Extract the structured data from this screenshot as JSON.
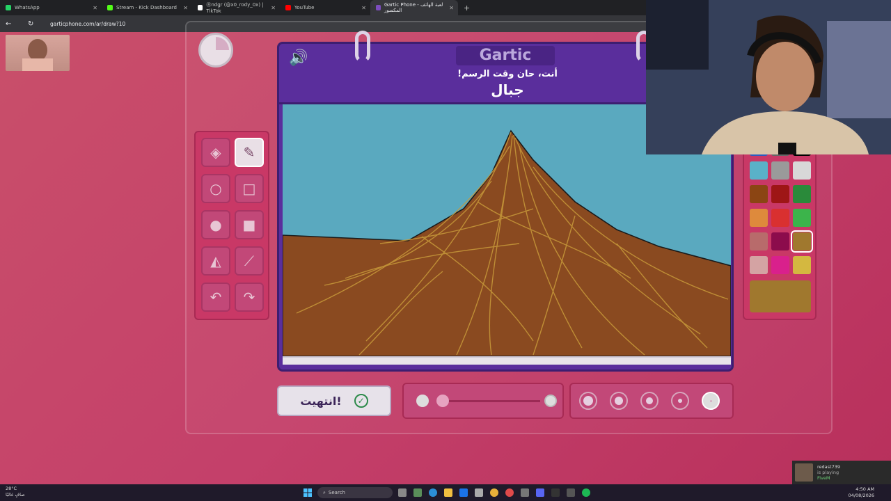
{
  "browser": {
    "tabs": [
      {
        "label": "WhatsApp",
        "color": "#25d366"
      },
      {
        "label": "Stream - Kick Dashboard",
        "color": "#53fc18"
      },
      {
        "label": "Ⓡndǥr (@x0_rody_0x) | TikTok",
        "color": "#ffffff"
      },
      {
        "label": "YouTube",
        "color": "#ff0000"
      },
      {
        "label": "Gartic Phone - لعبة الهاتف المكسور",
        "color": "#7c4dbd",
        "active": true
      }
    ],
    "url": "garticphone.com/ar/draw?10"
  },
  "game": {
    "logo": "Gartic",
    "prompt": "أنت، حان وقت الرسم!",
    "word": "جبال",
    "done_button": "انتهيت!",
    "timer_fraction_remaining": 0.25
  },
  "tools": [
    {
      "name": "eraser-tool",
      "icon": "eraser-icon",
      "glyph": "◈"
    },
    {
      "name": "pencil-tool",
      "icon": "pencil-icon",
      "glyph": "✎",
      "selected": true
    },
    {
      "name": "ellipse-outline-tool",
      "icon": "circle-outline-icon",
      "glyph": "○"
    },
    {
      "name": "rectangle-outline-tool",
      "icon": "square-outline-icon",
      "glyph": "□"
    },
    {
      "name": "ellipse-fill-tool",
      "icon": "circle-fill-icon",
      "glyph": "●"
    },
    {
      "name": "rectangle-fill-tool",
      "icon": "square-fill-icon",
      "glyph": "■"
    },
    {
      "name": "fill-bucket-tool",
      "icon": "bucket-icon",
      "glyph": "◭"
    },
    {
      "name": "line-tool",
      "icon": "line-icon",
      "glyph": "⟋"
    },
    {
      "name": "undo-tool",
      "icon": "undo-icon",
      "glyph": "↶"
    },
    {
      "name": "redo-tool",
      "icon": "redo-icon",
      "glyph": "↷"
    }
  ],
  "palette": {
    "colors": [
      "#2d5bbf",
      "#666666",
      "#000000",
      "#5ab1c8",
      "#9a9a9a",
      "#d8d8d8",
      "#8b4513",
      "#9e1616",
      "#2a8a3a",
      "#de8a3c",
      "#d93030",
      "#3cb44b",
      "#b86b6b",
      "#8c0c4c",
      "#a0782e",
      "#d4a3a3",
      "#d9208c",
      "#d4b840"
    ],
    "selected_index": 14,
    "current_color": "#a0782e"
  },
  "brush": {
    "opacity_fraction": 0.0,
    "size_options": 5,
    "selected_size_index": 4
  },
  "notification": {
    "user": "redast739",
    "status": "is playing",
    "game": "FiveM"
  },
  "taskbar": {
    "weather_temp": "28°C",
    "weather_desc": "صافٍ غالبًا",
    "search_label": "Search",
    "time": "4:50 AM",
    "date": "04/08/2026"
  }
}
